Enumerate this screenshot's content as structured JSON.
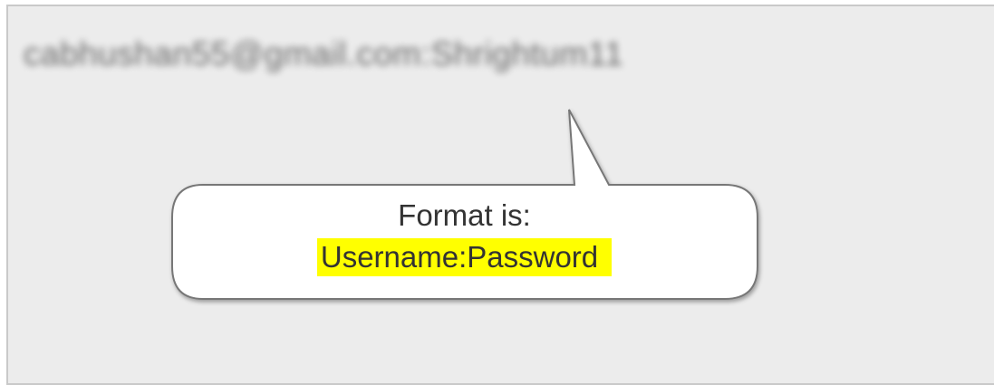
{
  "credential": {
    "text": "cabhushan55@gmail.com:Shrightum11"
  },
  "callout": {
    "line1": "Format is:",
    "line2": "Username:Password"
  },
  "colors": {
    "panel_background": "#ececec",
    "panel_border": "#c9c9c9",
    "callout_fill": "#ffffff",
    "callout_stroke": "#777777",
    "highlight": "#ffff00",
    "text": "#333333"
  }
}
